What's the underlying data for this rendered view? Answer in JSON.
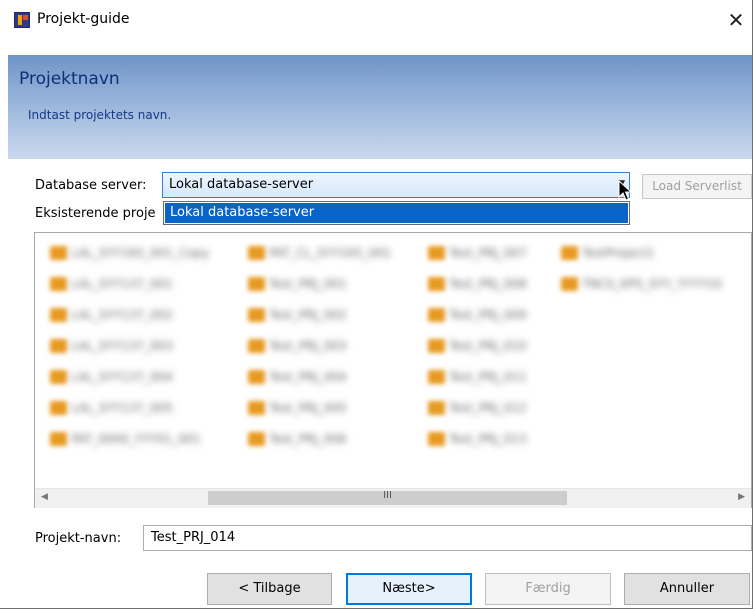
{
  "window": {
    "title": "Projekt-guide",
    "close_glyph": "✕"
  },
  "header": {
    "title": "Projektnavn",
    "subtitle": "Indtast projektets navn."
  },
  "server": {
    "label": "Database server:",
    "selected": "Lokal database-server",
    "options": [
      "Lokal database-server"
    ],
    "load_button": "Load Serverlist"
  },
  "existing": {
    "label": "Eksisterende proje",
    "items": [
      "LAL_SYY165_001_Copy",
      "PAT_CL_SYY165_001",
      "Test_PRJ_007",
      "TestProject1",
      "LAL_SYY137_001",
      "Test_PRJ_001",
      "Test_PRJ_008",
      "TNCS_KPS_SYY_YYYY10",
      "LAL_SYY137_002",
      "Test_PRJ_002",
      "Test_PRJ_009",
      "LAL_SYY137_003",
      "Test_PRJ_003",
      "Test_PRJ_010",
      "LAL_SYY137_004",
      "Test_PRJ_004",
      "Test_PRJ_011",
      "LAL_SYY137_005",
      "Test_PRJ_005",
      "Test_PRJ_012",
      "PAT_0000_YYY01_001",
      "Test_PRJ_006",
      "Test_PRJ_013"
    ]
  },
  "scrollbar": {
    "left": "◀",
    "right": "▶",
    "grip": "III"
  },
  "project_name": {
    "label": "Projekt-navn:",
    "value": "Test_PRJ_014"
  },
  "buttons": {
    "back": "< Tilbage",
    "next": "Næste>",
    "finish": "Færdig",
    "cancel": "Annuller"
  },
  "icons": {
    "app": "app-icon",
    "dropdown": "chevron-down-icon",
    "cursor": "mouse-cursor-icon"
  },
  "colors": {
    "header_top": "#6f94c8",
    "header_bottom": "#cbd9ee",
    "selection": "#0a64c8",
    "project_icon": "#e79a22"
  }
}
